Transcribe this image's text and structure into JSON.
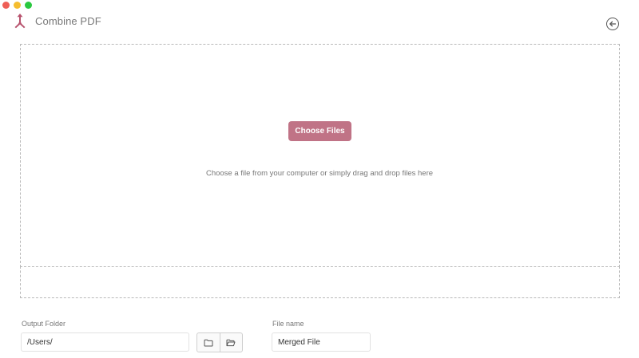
{
  "window": {
    "controls": [
      "close",
      "minimize",
      "maximize"
    ]
  },
  "header": {
    "logo_icon": "combine-arrows-icon",
    "title": "Combine PDF",
    "back_icon": "back-arrow-circle-icon"
  },
  "dropzone": {
    "choose_label": "Choose Files",
    "hint": "Choose a file from your computer or simply drag and drop files here"
  },
  "output": {
    "label": "Output Folder",
    "value": "/Users/",
    "browse_icon": "folder-icon",
    "open_icon": "folder-open-icon"
  },
  "filename": {
    "label": "File name",
    "value": "Merged File"
  },
  "colors": {
    "accent": "#c07386",
    "logo": "#b8536e"
  }
}
